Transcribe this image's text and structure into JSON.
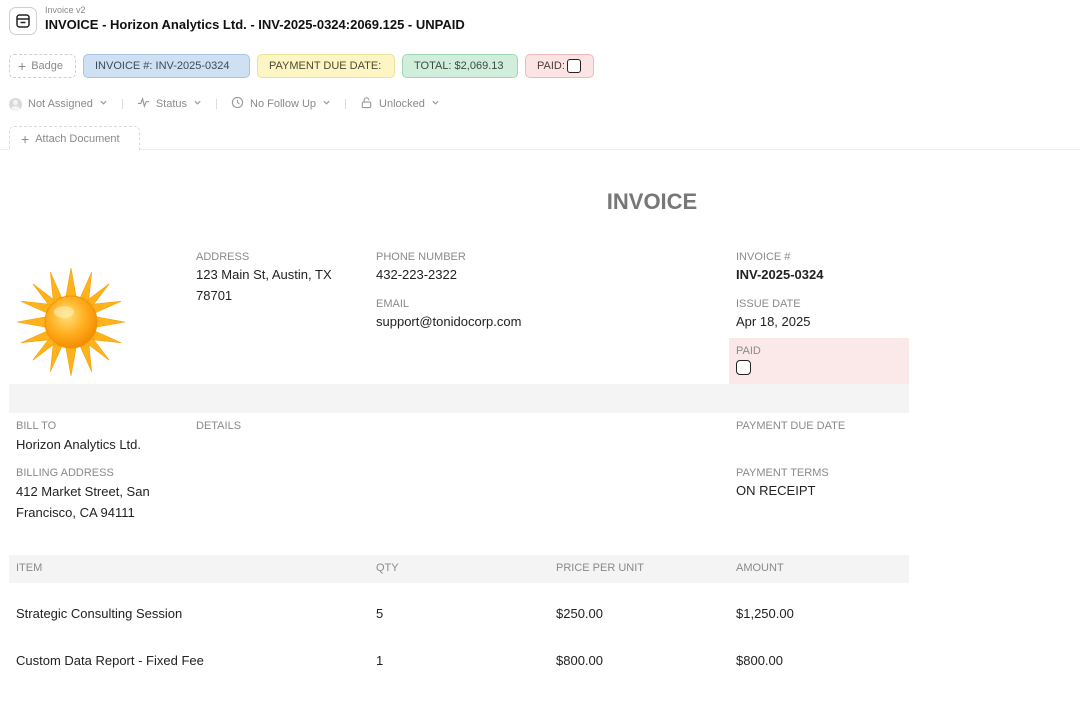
{
  "app": {
    "label": "Invoice v2",
    "title": "INVOICE - Horizon Analytics Ltd. - INV-2025-0324:2069.125 - UNPAID",
    "icon": "invoice-box-icon"
  },
  "badges": {
    "add_label": "Badge",
    "invoice_number": "INVOICE #: INV-2025-0324",
    "payment_due": "PAYMENT DUE DATE:",
    "total": "TOTAL: $2,069.13",
    "paid": "PAID:",
    "colors": {
      "invoice_number": "#cfe0f3",
      "payment_due": "#fdf6c4",
      "total": "#d1eedd",
      "paid": "#fde4e4"
    }
  },
  "meta": {
    "assignee": "Not Assigned",
    "status": "Status",
    "follow_up": "No Follow Up",
    "lock": "Unlocked"
  },
  "attach_label": "Attach Document",
  "invoice": {
    "heading": "INVOICE",
    "address_label": "ADDRESS",
    "address": "123 Main St, Austin, TX 78701",
    "phone_label": "PHONE NUMBER",
    "phone": "432-223-2322",
    "email_label": "EMAIL",
    "email": "support@tonidocorp.com",
    "invoice_no_label": "INVOICE #",
    "invoice_no": "INV-2025-0324",
    "issue_date_label": "ISSUE DATE",
    "issue_date": "Apr 18, 2025",
    "paid_label": "PAID",
    "paid_checked": false,
    "bill_to_label": "BILL TO",
    "bill_to": "Horizon Analytics Ltd.",
    "details_label": "DETAILS",
    "due_date_label": "PAYMENT DUE DATE",
    "billing_address_label": "BILLING ADDRESS",
    "billing_address": "412 Market Street, San Francisco, CA 94111",
    "terms_label": "PAYMENT TERMS",
    "terms": "ON RECEIPT"
  },
  "items": {
    "headers": [
      "ITEM",
      "QTY",
      "PRICE PER UNIT",
      "AMOUNT"
    ],
    "rows": [
      {
        "item": "Strategic Consulting Session",
        "qty": "5",
        "price": "$250.00",
        "amount": "$1,250.00"
      },
      {
        "item": "Custom Data Report - Fixed Fee",
        "qty": "1",
        "price": "$800.00",
        "amount": "$800.00"
      }
    ]
  }
}
